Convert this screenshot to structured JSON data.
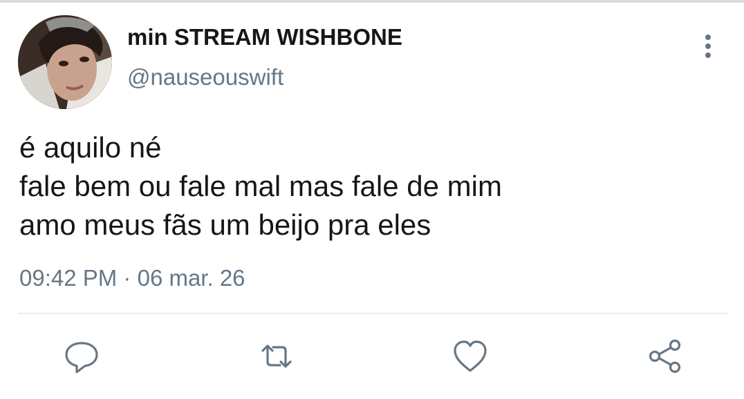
{
  "tweet": {
    "author": {
      "display_name": "min STREAM WISHBONE",
      "handle": "@nauseouswift",
      "avatar_icon": "profile-photo"
    },
    "text_lines": [
      "é aquilo né",
      "fale bem ou fale mal mas fale de mim",
      "amo meus fãs um beijo pra eles"
    ],
    "time": "09:42 PM",
    "separator": "·",
    "date": "06 mar. 26"
  },
  "actions": [
    {
      "name": "reply",
      "icon": "reply-icon"
    },
    {
      "name": "retweet",
      "icon": "retweet-icon"
    },
    {
      "name": "like",
      "icon": "heart-icon"
    },
    {
      "name": "share",
      "icon": "share-icon"
    }
  ],
  "menu": {
    "icon": "more-vertical-icon"
  },
  "colors": {
    "primary_text": "#14171a",
    "secondary_text": "#657786",
    "divider": "#e6ecf0",
    "icon": "#687684"
  }
}
